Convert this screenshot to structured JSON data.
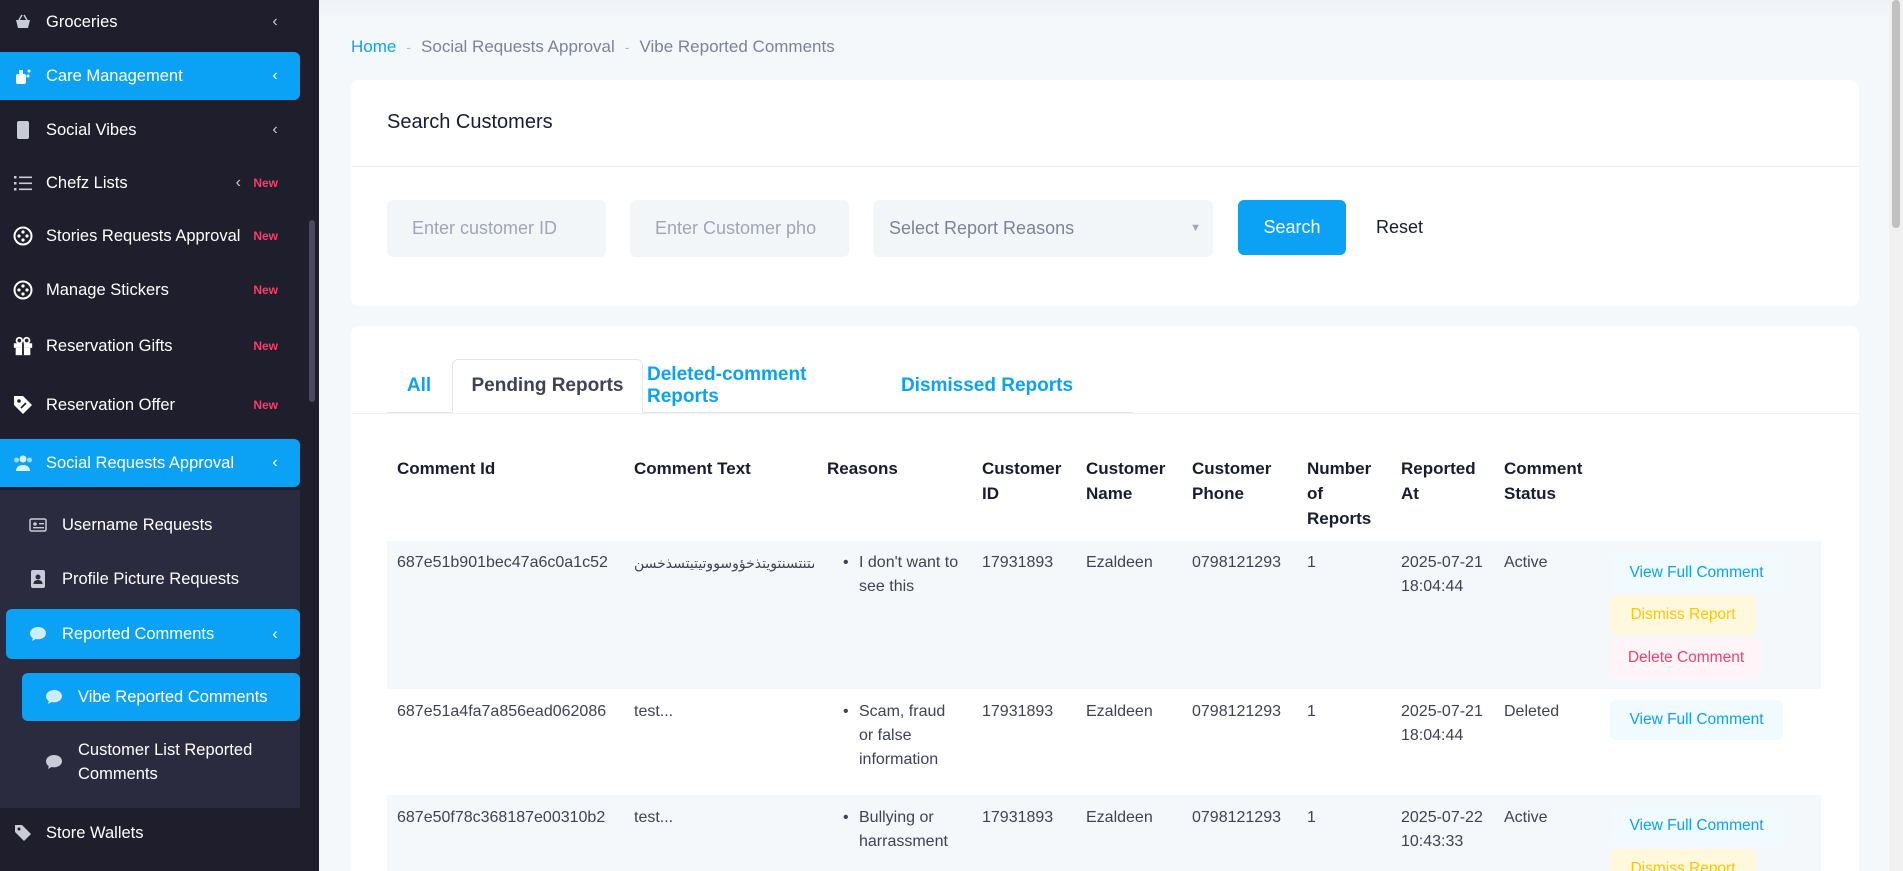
{
  "sidebar": {
    "items": [
      {
        "label": "Groceries",
        "icon": "basket-icon"
      },
      {
        "label": "Care Management",
        "icon": "care-icon"
      },
      {
        "label": "Social Vibes",
        "icon": "phone-icon"
      },
      {
        "label": "Chefz Lists",
        "icon": "list-icon",
        "badge": "New"
      },
      {
        "label": "Stories Requests Approval",
        "icon": "reel-icon",
        "badge": "New"
      },
      {
        "label": "Manage Stickers",
        "icon": "reel-icon",
        "badge": "New"
      },
      {
        "label": "Reservation Gifts",
        "icon": "gift-icon",
        "badge": "New"
      },
      {
        "label": "Reservation Offer",
        "icon": "offer-tag-icon",
        "badge": "New"
      },
      {
        "label": "Social Requests Approval",
        "icon": "users-icon"
      },
      {
        "label": "Store Wallets",
        "icon": "tag-icon"
      }
    ],
    "sub_items": [
      {
        "label": "Username Requests",
        "icon": "id-card-icon"
      },
      {
        "label": "Profile Picture Requests",
        "icon": "portrait-icon"
      },
      {
        "label": "Reported Comments",
        "icon": "chat-icon"
      },
      {
        "label": "Vibe Reported Comments",
        "icon": "chat-icon"
      },
      {
        "label": "Customer List Reported Comments",
        "icon": "chat-icon"
      }
    ]
  },
  "breadcrumb": {
    "home": "Home",
    "crumbs": [
      "Social Requests Approval",
      "Vibe Reported Comments"
    ],
    "separator": "-"
  },
  "search": {
    "title": "Search Customers",
    "customer_id_placeholder": "Enter customer ID",
    "phone_placeholder": "Enter Customer pho",
    "reasons_placeholder": "Select Report Reasons",
    "search_label": "Search",
    "reset_label": "Reset"
  },
  "tabs": [
    {
      "label": "All"
    },
    {
      "label": "Pending Reports"
    },
    {
      "label": "Deleted-comment Reports"
    },
    {
      "label": "Dismissed Reports"
    }
  ],
  "table": {
    "headers": [
      "Comment Id",
      "Comment Text",
      "Reasons",
      "Customer ID",
      "Customer Name",
      "Customer Phone",
      "Number of Reports",
      "Reported At",
      "Comment Status"
    ],
    "rows": [
      {
        "comment_id": "687e51b901bec47a6c0a1c52",
        "text": "تستنتسنتويتذخؤوسووتيتيتسذخسن...",
        "reason": "I don't want to see this",
        "customer_id": "17931893",
        "name": "Ezaldeen",
        "phone": "0798121293",
        "reports": "1",
        "reported_at": "2025-07-21 18:04:44",
        "status": "Active"
      },
      {
        "comment_id": "687e51a4fa7a856ead062086",
        "text": "test...",
        "reason": "Scam, fraud or false information",
        "customer_id": "17931893",
        "name": "Ezaldeen",
        "phone": "0798121293",
        "reports": "1",
        "reported_at": "2025-07-21 18:04:44",
        "status": "Deleted"
      },
      {
        "comment_id": "687e50f78c368187e00310b2",
        "text": "test...",
        "reason": "Bullying or harrassment",
        "customer_id": "17931893",
        "name": "Ezaldeen",
        "phone": "0798121293",
        "reports": "1",
        "reported_at": "2025-07-22 10:43:33",
        "status": "Active"
      }
    ],
    "actions": {
      "view": "View Full Comment",
      "dismiss": "Dismiss Report",
      "delete": "Delete Comment"
    }
  },
  "colors": {
    "accent": "#0ba2f5",
    "sidebar_bg": "#1e1e2d",
    "new_badge": "#f1416c"
  }
}
